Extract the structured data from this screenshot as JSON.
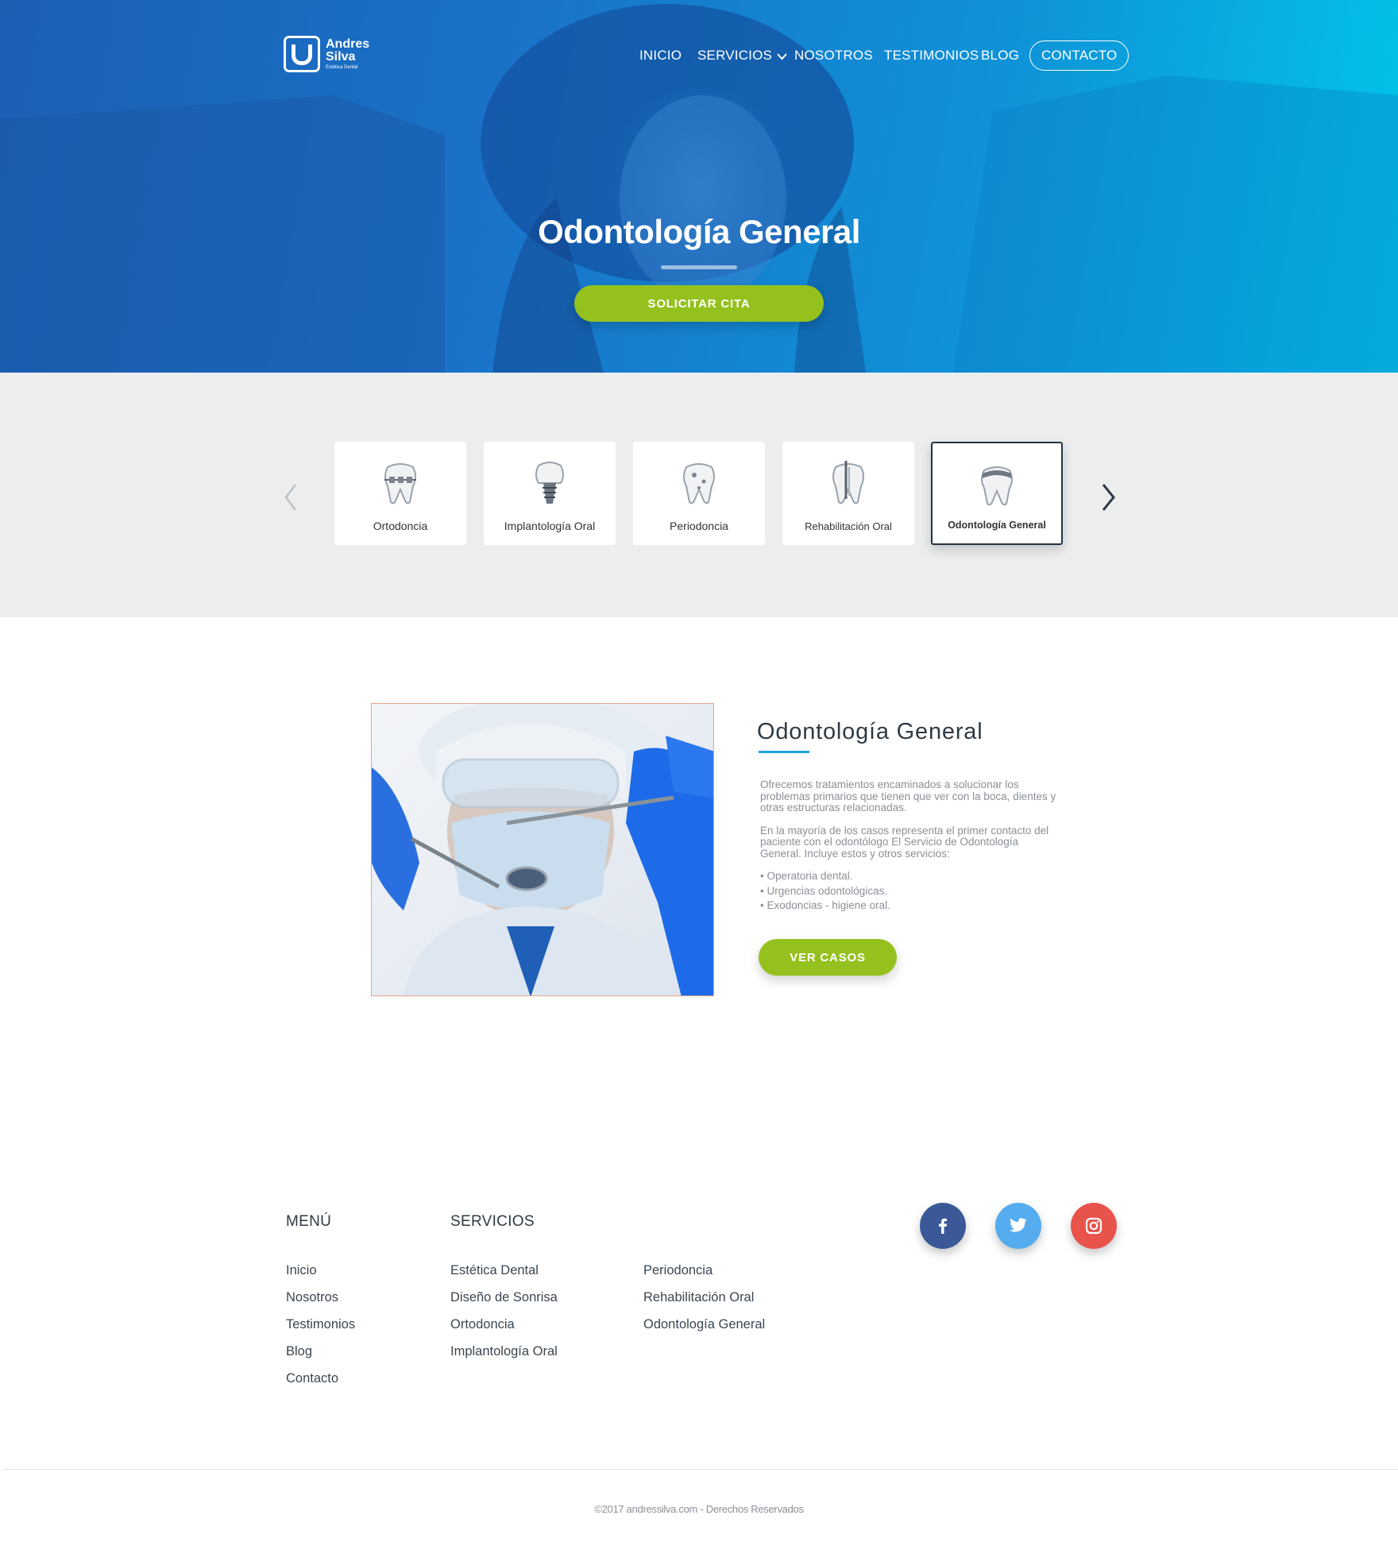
{
  "brand": {
    "name_line1": "Andres",
    "name_line2": "Silva",
    "tagline": "Estética Dental"
  },
  "nav": {
    "items": [
      {
        "label": "INICIO"
      },
      {
        "label": "SERVICIOS"
      },
      {
        "label": "NOSOTROS"
      },
      {
        "label": "TESTIMONIOS"
      },
      {
        "label": "BLOG"
      }
    ],
    "cta": "CONTACTO"
  },
  "hero": {
    "title": "Odontología General",
    "button": "SOLICITAR CITA"
  },
  "services_carousel": {
    "items": [
      {
        "label": "Ortodoncia",
        "icon": "tooth-braces-icon"
      },
      {
        "label": "Implantología Oral",
        "icon": "tooth-implant-icon"
      },
      {
        "label": "Periodoncia",
        "icon": "tooth-decay-icon"
      },
      {
        "label": "Rehabilitación Oral",
        "icon": "tooth-root-canal-icon"
      },
      {
        "label": "Odontología General",
        "icon": "tooth-crown-icon",
        "active": true
      }
    ]
  },
  "content": {
    "title": "Odontología General",
    "paragraph1": "Ofrecemos tratamientos encaminados a solucionar los problemas primarios que tienen que ver con la boca, dientes y otras estructuras relacionadas.",
    "paragraph2": "En la mayoría de los casos representa el primer contacto del paciente con el odontólogo El Servicio de Odontología General. Incluye estos y otros servicios:",
    "bullets": [
      "Operatoria dental.",
      "Urgencias odontológicas.",
      "Exodoncias - higiene oral."
    ],
    "button": "VER CASOS"
  },
  "footer": {
    "menu_heading": "MENÚ",
    "menu": [
      "Inicio",
      "Nosotros",
      "Testimonios",
      "Blog",
      "Contacto"
    ],
    "services_heading": "SERVICIOS",
    "services_col1": [
      "Estética Dental",
      "Diseño de Sonrisa",
      "Ortodoncia",
      "Implantología Oral"
    ],
    "services_col2": [
      "Periodoncia",
      "Rehabilitación Oral",
      "Odontología General"
    ],
    "social": [
      {
        "name": "facebook",
        "icon": "facebook-icon",
        "color": "#3b5998"
      },
      {
        "name": "twitter",
        "icon": "twitter-icon",
        "color": "#55acee"
      },
      {
        "name": "instagram",
        "icon": "instagram-icon",
        "color": "#e8534c"
      }
    ],
    "copyright": "©2017 andressilva.com - Derechos Reservados"
  },
  "colors": {
    "accent_green": "#95c11f",
    "accent_blue": "#1fa2dc",
    "hero_gradient_start": "#1b5fb5",
    "hero_gradient_end": "#00c6ea",
    "strip_bg": "#eceeee",
    "text_dark": "#2f3a44"
  }
}
